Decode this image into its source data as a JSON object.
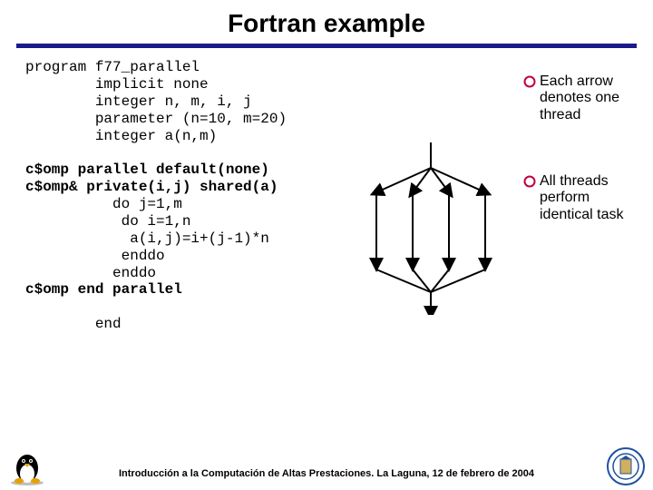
{
  "title": "Fortran example",
  "code": {
    "l1": "program f77_parallel",
    "l2": "        implicit none",
    "l3": "        integer n, m, i, j",
    "l4": "        parameter (n=10, m=20)",
    "l5": "        integer a(n,m)",
    "l6": "",
    "l7": "c$omp parallel default(none)",
    "l8": "c$omp& private(i,j) shared(a)",
    "l9": "          do j=1,m",
    "l10": "           do i=1,n",
    "l11": "            a(i,j)=i+(j-1)*n",
    "l12": "           enddo",
    "l13": "          enddo",
    "l14": "c$omp end parallel",
    "l15": "",
    "l16": "        end"
  },
  "bullets": {
    "b1": "Each arrow denotes one thread",
    "b2": "All threads perform identical task"
  },
  "footer": "Introducción a la Computación de Altas Prestaciones. La Laguna, 12 de febrero de 2004"
}
